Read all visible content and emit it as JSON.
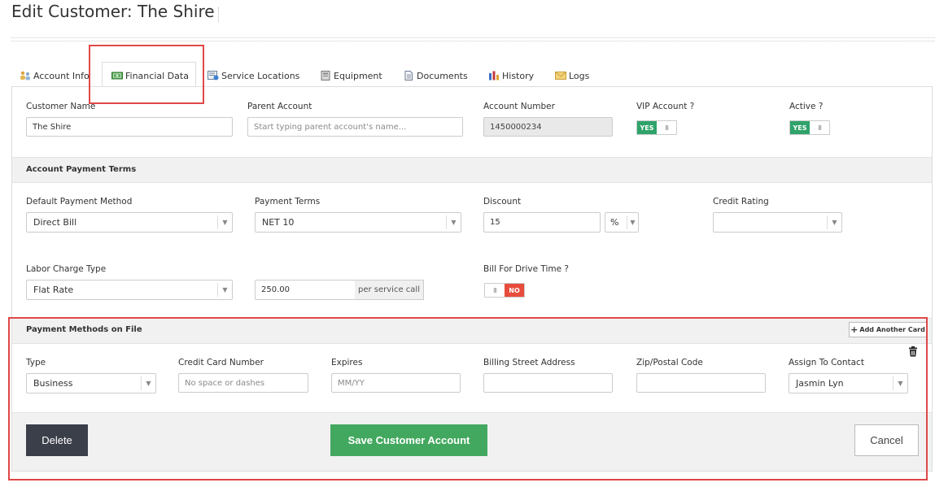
{
  "page": {
    "title": "Edit Customer: The Shire"
  },
  "tabs": [
    {
      "label": "Account Info",
      "icon": "people-icon",
      "active": false
    },
    {
      "label": "Financial Data",
      "icon": "money-icon",
      "active": true
    },
    {
      "label": "Service Locations",
      "icon": "map-location-icon",
      "active": false
    },
    {
      "label": "Equipment",
      "icon": "equipment-icon",
      "active": false
    },
    {
      "label": "Documents",
      "icon": "document-icon",
      "active": false
    },
    {
      "label": "History",
      "icon": "history-chart-icon",
      "active": false
    },
    {
      "label": "Logs",
      "icon": "envelope-icon",
      "active": false
    }
  ],
  "account": {
    "customer_name_label": "Customer Name",
    "customer_name_value": "The Shire",
    "parent_account_label": "Parent Account",
    "parent_account_placeholder": "Start typing parent account's name...",
    "account_number_label": "Account Number",
    "account_number_value": "1450000234",
    "vip_label": "VIP Account ?",
    "vip_toggle": "YES",
    "active_label": "Active ?",
    "active_toggle": "YES",
    "toggle_grip": "III"
  },
  "payment_terms": {
    "section_title": "Account Payment Terms",
    "default_method_label": "Default Payment Method",
    "default_method_value": "Direct Bill",
    "terms_label": "Payment Terms",
    "terms_value": "NET 10",
    "discount_label": "Discount",
    "discount_value": "15",
    "discount_unit": "%",
    "credit_rating_label": "Credit Rating",
    "credit_rating_value": "",
    "labor_type_label": "Labor Charge Type",
    "labor_type_value": "Flat Rate",
    "labor_amount_value": "250.00",
    "labor_amount_suffix": "per service call",
    "drive_time_label": "Bill For Drive Time ?",
    "drive_time_toggle": "NO"
  },
  "payment_methods": {
    "section_title": "Payment Methods on File",
    "add_card_label": "Add Another Card",
    "type_label": "Type",
    "type_value": "Business",
    "card_number_label": "Credit Card Number",
    "card_number_placeholder": "No space or dashes",
    "expires_label": "Expires",
    "expires_placeholder": "MM/YY",
    "street_label": "Billing Street Address",
    "zip_label": "Zip/Postal Code",
    "contact_label": "Assign To Contact",
    "contact_value": "Jasmin Lyn"
  },
  "footer": {
    "delete_label": "Delete",
    "save_label": "Save Customer Account",
    "cancel_label": "Cancel"
  },
  "colors": {
    "toggle_yes": "#2fa36b",
    "toggle_no": "#e74c3c",
    "save_button": "#43a85f",
    "delete_button": "#3b3f4a",
    "highlight": "#e04848"
  }
}
